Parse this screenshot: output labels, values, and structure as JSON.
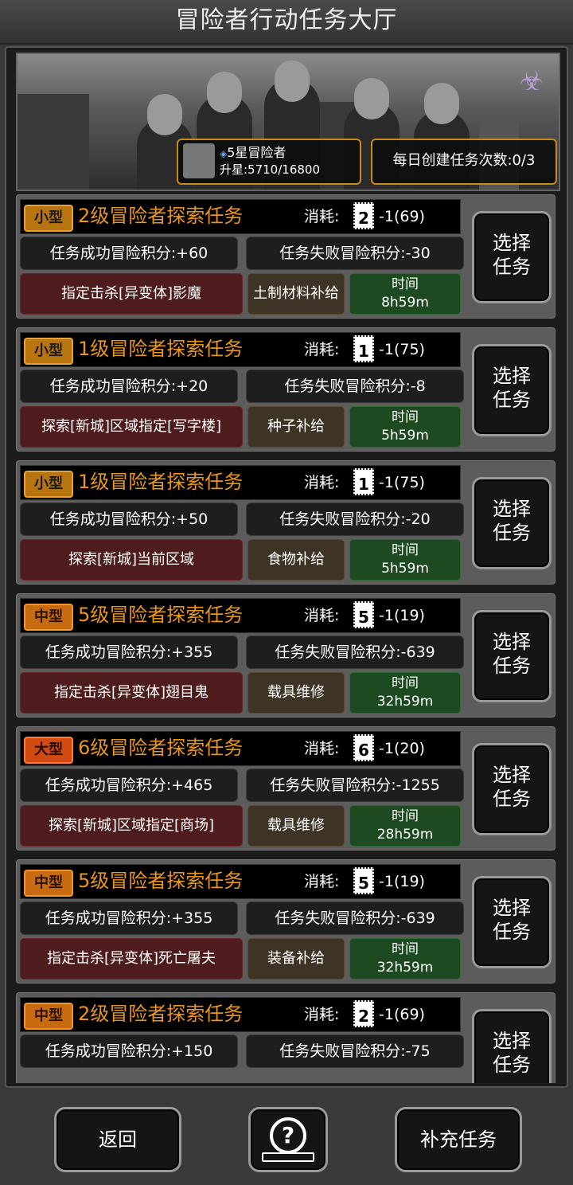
{
  "header": {
    "title": "冒险者行动任务大厅"
  },
  "banner": {
    "rank_title": "5星冒险者",
    "rank_progress": "升星:5710/16800",
    "daily_create": "每日创建任务次数:0/3"
  },
  "common": {
    "cost_label": "消耗:",
    "select_l1": "选择",
    "select_l2": "任务",
    "time_label": "时间"
  },
  "tasks": [
    {
      "size": "小型",
      "name": "2级冒险者探索任务",
      "card_num": "2",
      "cost": "-1(69)",
      "success": "任务成功冒险积分:+60",
      "fail": "任务失败冒险积分:-30",
      "target": "指定击杀[异变体]影魔",
      "reward": "土制材料补给",
      "time": "8h59m"
    },
    {
      "size": "小型",
      "name": "1级冒险者探索任务",
      "card_num": "1",
      "cost": "-1(75)",
      "success": "任务成功冒险积分:+20",
      "fail": "任务失败冒险积分:-8",
      "target": "探索[新城]区域指定[写字楼]",
      "reward": "种子补给",
      "time": "5h59m"
    },
    {
      "size": "小型",
      "name": "1级冒险者探索任务",
      "card_num": "1",
      "cost": "-1(75)",
      "success": "任务成功冒险积分:+50",
      "fail": "任务失败冒险积分:-20",
      "target": "探索[新城]当前区域",
      "reward": "食物补给",
      "time": "5h59m"
    },
    {
      "size": "中型",
      "name": "5级冒险者探索任务",
      "card_num": "5",
      "cost": "-1(19)",
      "success": "任务成功冒险积分:+355",
      "fail": "任务失败冒险积分:-639",
      "target": "指定击杀[异变体]翅目鬼",
      "reward": "载具维修",
      "time": "32h59m"
    },
    {
      "size": "大型",
      "name": "6级冒险者探索任务",
      "card_num": "6",
      "cost": "-1(20)",
      "success": "任务成功冒险积分:+465",
      "fail": "任务失败冒险积分:-1255",
      "target": "探索[新城]区域指定[商场]",
      "reward": "载具维修",
      "time": "28h59m"
    },
    {
      "size": "中型",
      "name": "5级冒险者探索任务",
      "card_num": "5",
      "cost": "-1(19)",
      "success": "任务成功冒险积分:+355",
      "fail": "任务失败冒险积分:-639",
      "target": "指定击杀[异变体]死亡屠夫",
      "reward": "装备补给",
      "time": "32h59m"
    },
    {
      "size": "中型",
      "name": "2级冒险者探索任务",
      "card_num": "2",
      "cost": "-1(69)",
      "success": "任务成功冒险积分:+150",
      "fail": "任务失败冒险积分:-75"
    }
  ],
  "footer": {
    "back": "返回",
    "help": "?",
    "refill": "补充任务"
  }
}
